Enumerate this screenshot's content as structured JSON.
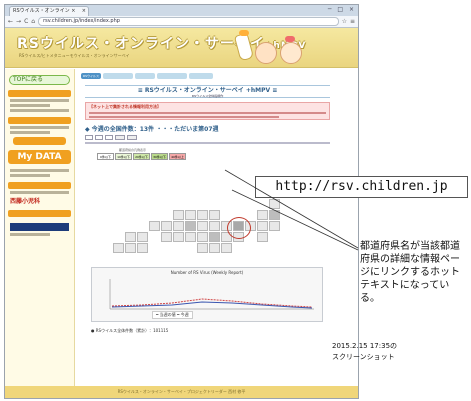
{
  "browser": {
    "tab_title": "RSウイルス・オンライン ×",
    "tab_close": "×",
    "window_controls": "─ □ ×",
    "url": "rsv.children.jp/index/index.php",
    "nav_back": "←",
    "nav_forward": "→",
    "nav_reload": "C",
    "nav_home": "⌂"
  },
  "site": {
    "logo": "RSウイルス・オンライン・サーベイ",
    "logo_suffix": "+hMPV",
    "logo_sub": "RSウイルス/ヒトメタニューモウイルス・オンラインサーベイ"
  },
  "sidebar": {
    "top_button": "TOPに戻る",
    "mydata": "My DATA",
    "sponsor": "西藤小児科"
  },
  "main": {
    "nav_tabs": [
      "RSウイルス",
      "",
      "",
      "",
      ""
    ],
    "page_title": "≡ RSウイルス・オンライン・サーベイ +hMPV ≡",
    "page_subtitle": "RSウイルス全体指標作",
    "alert_title": "【ネット上で集計される情報利用方法】",
    "weekly_heading": "◆ 今週の全国件数：13件 ・・・ただいま第07週",
    "legend_head": "都道府県の凡例表示",
    "legend_labels": [
      "0件以下",
      "10件以下",
      "20件以下",
      "30件以下",
      "40件以上"
    ],
    "legend_colors": [
      "#ffffff",
      "#eaf6d7",
      "#cfe8a8",
      "#b9d98a",
      "#f4a7a7"
    ],
    "chart_title": "Number of RS Virus (Weekly Report)",
    "chart_legend": "━ 当週の値  ━ 今週",
    "note": "● RSウイルス全体件数（累計）：101115",
    "footer": "RSウイルス・オンライン・サーベイ・プロジェクトリーダー 西村 修平"
  },
  "callouts": {
    "url_text": "http://rsv.children.jp",
    "explain_text": "都道府県名が当該都道府県の詳細な情報ページにリンクするホットテキストになっている。",
    "screenshot_note": "2015.2.15 17:35の\nスクリーンショット"
  }
}
